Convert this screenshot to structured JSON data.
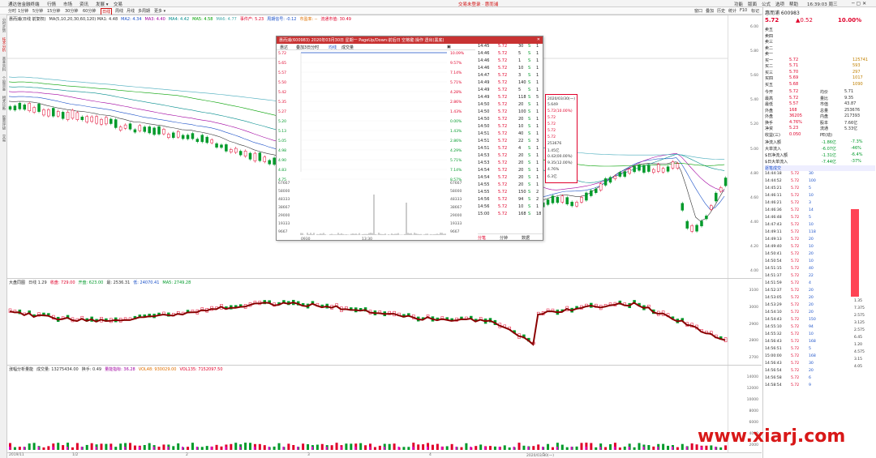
{
  "menu": {
    "left": [
      "通达信金融终端",
      "行情",
      "市场",
      "资讯",
      "发展 ▾",
      "交易"
    ],
    "center": "交易未登录 · 惠而浦",
    "right": [
      "功能",
      "版面",
      "公式",
      "选项",
      "帮助"
    ],
    "time": "16:39:03 周三"
  },
  "toolbar": {
    "periods": [
      "分时",
      "1分钟",
      "5分钟",
      "15分钟",
      "30分钟",
      "60分钟",
      "日线",
      "周线",
      "月线",
      "多周期",
      "更多 ▾"
    ],
    "right": [
      "窗口",
      "叠加",
      "历史",
      "统计",
      "F10",
      "标记",
      "收起"
    ]
  },
  "leftstrip": [
    "分时走势",
    "技术分析",
    "基本资料",
    "个股资金",
    "相关诊断",
    "股票评级",
    "交易"
  ],
  "main": {
    "legend": [
      {
        "t": "惠而浦(日线 前复权)",
        "c": "#222"
      },
      {
        "t": "MA(5,10,20,30,60,120) MA1: 4.48",
        "c": "#333"
      },
      {
        "t": "MA2: 4.34",
        "c": "#1a50c8"
      },
      {
        "t": "MA3: 4.40",
        "c": "#a000a0"
      },
      {
        "t": "MA4: 4.42",
        "c": "#008c8c"
      },
      {
        "t": "MA5: 4.58",
        "c": "#00a000"
      },
      {
        "t": "MA6: 4.77",
        "c": "#4aa"
      },
      {
        "t": "事件产: 5.23",
        "c": "#e0002a"
      },
      {
        "t": "周期信号: -0.12",
        "c": "#1a50c8"
      },
      {
        "t": "市盈率: --",
        "c": "#e07000"
      },
      {
        "t": "流通市值: 30.49",
        "c": "#e0002a"
      }
    ],
    "yticks": [
      "6.00",
      "5.80",
      "5.60",
      "5.40",
      "5.20",
      "5.00",
      "4.80",
      "4.60",
      "4.40",
      "4.20",
      "4.00"
    ],
    "annotations": [
      "5.72",
      "4.81",
      "诱多",
      "诱多",
      "诱多"
    ]
  },
  "index": {
    "legend": [
      {
        "t": "大盘同图",
        "c": "#222"
      },
      {
        "t": "日线  1.29",
        "c": "#333"
      },
      {
        "t": "收盘: 729.00",
        "c": "#e0002a"
      },
      {
        "t": "开盘: 623.00",
        "c": "#009a2a"
      },
      {
        "t": "最: 2536.31",
        "c": "#333"
      },
      {
        "t": "低: 24070.41",
        "c": "#1a50c8"
      },
      {
        "t": "MA5: 2749.28",
        "c": "#009a2a"
      }
    ],
    "yticks": [
      "3100",
      "3000",
      "2900",
      "2800",
      "2700"
    ]
  },
  "volume": {
    "legend": [
      {
        "t": "涨幅分析量能",
        "c": "#222"
      },
      {
        "t": "成交量: 13275434.00",
        "c": "#333"
      },
      {
        "t": "换手: 0.49",
        "c": "#333"
      },
      {
        "t": "量能指标: 36.28",
        "c": "#a000a0"
      },
      {
        "t": "VOL48: 930029.00",
        "c": "#e07000"
      },
      {
        "t": "VOL135: 7152097.50",
        "c": "#e0002a"
      }
    ],
    "yticks": [
      "14000",
      "12000",
      "10000",
      "8000",
      "6000",
      "4000",
      "2000"
    ]
  },
  "xaxis": [
    "2019/11",
    "1/2",
    "2",
    "3",
    "4",
    "5",
    "2020/03/30(一)"
  ],
  "popup": {
    "title": "惠而浦(600983) 2020年03月30日 星期一 PageUp/Down:前后日 空格键:操作 透出(黑底)",
    "tabs": [
      "惠达",
      "叠加3日分时",
      "均线",
      "成交量"
    ],
    "leftaxis": [
      "5.72",
      "5.65",
      "5.57",
      "5.50",
      "5.42",
      "5.35",
      "5.27",
      "5.20",
      "5.13",
      "5.05",
      "4.98",
      "4.90",
      "4.83",
      "4.75"
    ],
    "rightaxis": [
      "10.09%",
      "9.57%",
      "7.14%",
      "5.71%",
      "4.28%",
      "2.86%",
      "1.43%",
      "0.00%",
      "1.43%",
      "2.86%",
      "4.29%",
      "5.71%",
      "7.14%",
      "8.57%"
    ],
    "volaxis": [
      "67667",
      "58000",
      "48333",
      "38667",
      "29000",
      "19333",
      "9667"
    ],
    "timelabels": [
      "0930",
      "13:30"
    ],
    "bottomtabs": [
      "分笔",
      "分钟",
      "数据"
    ],
    "ticks": [
      [
        "14:45",
        "5.72",
        "30",
        "S",
        "1"
      ],
      [
        "14:46",
        "5.72",
        "5",
        "S",
        "1"
      ],
      [
        "14:46",
        "5.72",
        "1",
        "S",
        "1"
      ],
      [
        "14:46",
        "5.72",
        "10",
        "S",
        "1"
      ],
      [
        "14:47",
        "5.72",
        "3",
        "S",
        "1"
      ],
      [
        "14:49",
        "5.72",
        "140",
        "S",
        "1"
      ],
      [
        "14:49",
        "5.72",
        "5",
        "S",
        "1"
      ],
      [
        "14:49",
        "5.72",
        "118",
        "S",
        "5"
      ],
      [
        "14:50",
        "5.72",
        "20",
        "S",
        "1"
      ],
      [
        "14:50",
        "5.72",
        "100",
        "S",
        "1"
      ],
      [
        "14:50",
        "5.72",
        "20",
        "S",
        "1"
      ],
      [
        "14:50",
        "5.72",
        "10",
        "S",
        "1"
      ],
      [
        "14:51",
        "5.72",
        "40",
        "S",
        "1"
      ],
      [
        "14:51",
        "5.72",
        "22",
        "S",
        "3"
      ],
      [
        "14:51",
        "5.72",
        "4",
        "S",
        "1"
      ],
      [
        "14:53",
        "5.72",
        "20",
        "S",
        "1"
      ],
      [
        "14:53",
        "5.72",
        "20",
        "S",
        "1"
      ],
      [
        "14:54",
        "5.72",
        "20",
        "S",
        "1"
      ],
      [
        "14:54",
        "5.72",
        "20",
        "S",
        "1"
      ],
      [
        "14:55",
        "5.72",
        "20",
        "S",
        "1"
      ],
      [
        "14:55",
        "5.72",
        "150",
        "S",
        "2"
      ],
      [
        "14:56",
        "5.72",
        "94",
        "S",
        "2"
      ],
      [
        "14:56",
        "5.72",
        "10",
        "S",
        "1"
      ],
      [
        "15:00",
        "5.72",
        "168",
        "S",
        "18"
      ]
    ],
    "infobox": [
      "2020/03/30(一)",
      "5.649",
      "5.72(10.00%)",
      "5.72",
      "5.72",
      "5.72",
      "5.72",
      "253676",
      "1.45亿",
      "0.42(00.00%)",
      "9.35(12.00%)",
      "4.76%",
      "6.3亿"
    ]
  },
  "quote": {
    "name": "惠而浦",
    "code": "600983",
    "price": "5.72",
    "change": "▲0.52",
    "pct": "10.00%",
    "sells": [
      [
        "卖五",
        "",
        ""
      ],
      [
        "卖四",
        "",
        ""
      ],
      [
        "卖三",
        "",
        ""
      ],
      [
        "卖二",
        "",
        ""
      ],
      [
        "卖一",
        "",
        ""
      ]
    ],
    "buys": [
      [
        "买一",
        "5.72",
        "125741"
      ],
      [
        "买二",
        "5.71",
        "593"
      ],
      [
        "买三",
        "5.70",
        "297"
      ],
      [
        "买四",
        "5.69",
        "1017"
      ],
      [
        "买五",
        "5.68",
        "1090"
      ]
    ],
    "stats": [
      [
        "今开",
        "5.72",
        "均价",
        "5.71"
      ],
      [
        "最高",
        "5.72",
        "量比",
        "9.35"
      ],
      [
        "最低",
        "5.57",
        "市值",
        "43.87"
      ],
      [
        "外盘",
        "168",
        "总量",
        "253676"
      ],
      [
        "外盘",
        "36205",
        "内盘",
        "217393"
      ],
      [
        "换手",
        "4.76%",
        "股本",
        "7.66亿"
      ],
      [
        "净资",
        "5.23",
        "流通",
        "5.33亿"
      ],
      [
        "收益(三)",
        "0.050",
        "PE(动)",
        ""
      ]
    ],
    "flow": [
      [
        "净流入额",
        "-1.86亿",
        "-7.3%"
      ],
      [
        "大单流入",
        "-6.07亿",
        "-46%"
      ],
      [
        "$日净流入额",
        "-1.31亿",
        "-6.4%"
      ],
      [
        "$日大单流入",
        "-7.44亿",
        "-37%"
      ]
    ],
    "tickhdr": "逐笔成交",
    "ticks": [
      [
        "14:44:18",
        "5.72",
        "30"
      ],
      [
        "14:44:52",
        "5.72",
        "100"
      ],
      [
        "14:45:21",
        "5.72",
        "5"
      ],
      [
        "14:46:11",
        "5.72",
        "10"
      ],
      [
        "14:46:21",
        "5.72",
        "3"
      ],
      [
        "14:46:36",
        "5.72",
        "14"
      ],
      [
        "14:46:48",
        "5.72",
        "5"
      ],
      [
        "14:47:43",
        "5.72",
        "10"
      ],
      [
        "14:49:11",
        "5.72",
        "118"
      ],
      [
        "14:49:13",
        "5.72",
        "20"
      ],
      [
        "14:49:40",
        "5.72",
        "10"
      ],
      [
        "14:50:41",
        "5.72",
        "20"
      ],
      [
        "14:50:54",
        "5.72",
        "10"
      ],
      [
        "14:51:15",
        "5.72",
        "40"
      ],
      [
        "14:51:37",
        "5.72",
        "22"
      ],
      [
        "14:51:59",
        "5.72",
        "4"
      ],
      [
        "14:52:37",
        "5.72",
        "20"
      ],
      [
        "14:53:05",
        "5.72",
        "20"
      ],
      [
        "14:53:29",
        "5.72",
        "20"
      ],
      [
        "14:54:10",
        "5.72",
        "20"
      ],
      [
        "14:54:43",
        "5.72",
        "150"
      ],
      [
        "14:55:10",
        "5.72",
        "94"
      ],
      [
        "14:55:32",
        "5.72",
        "10"
      ],
      [
        "14:56:43",
        "5.72",
        "168"
      ],
      [
        "14:56:51",
        "5.72",
        "5"
      ],
      [
        "15:00:00",
        "5.72",
        "168"
      ],
      [
        "14:56:43",
        "5.72",
        "30"
      ],
      [
        "14:56:54",
        "5.72",
        "20"
      ],
      [
        "14:56:58",
        "5.72",
        "6"
      ],
      [
        "14:58:54",
        "5.72",
        "9"
      ]
    ],
    "sidenums": [
      "1.35",
      "7.375",
      "2.575",
      "3.125",
      "2.575",
      "6.45",
      "1.20",
      "4.575",
      "3.15",
      "4.05"
    ]
  },
  "watermark": "www.xiarj.com"
}
